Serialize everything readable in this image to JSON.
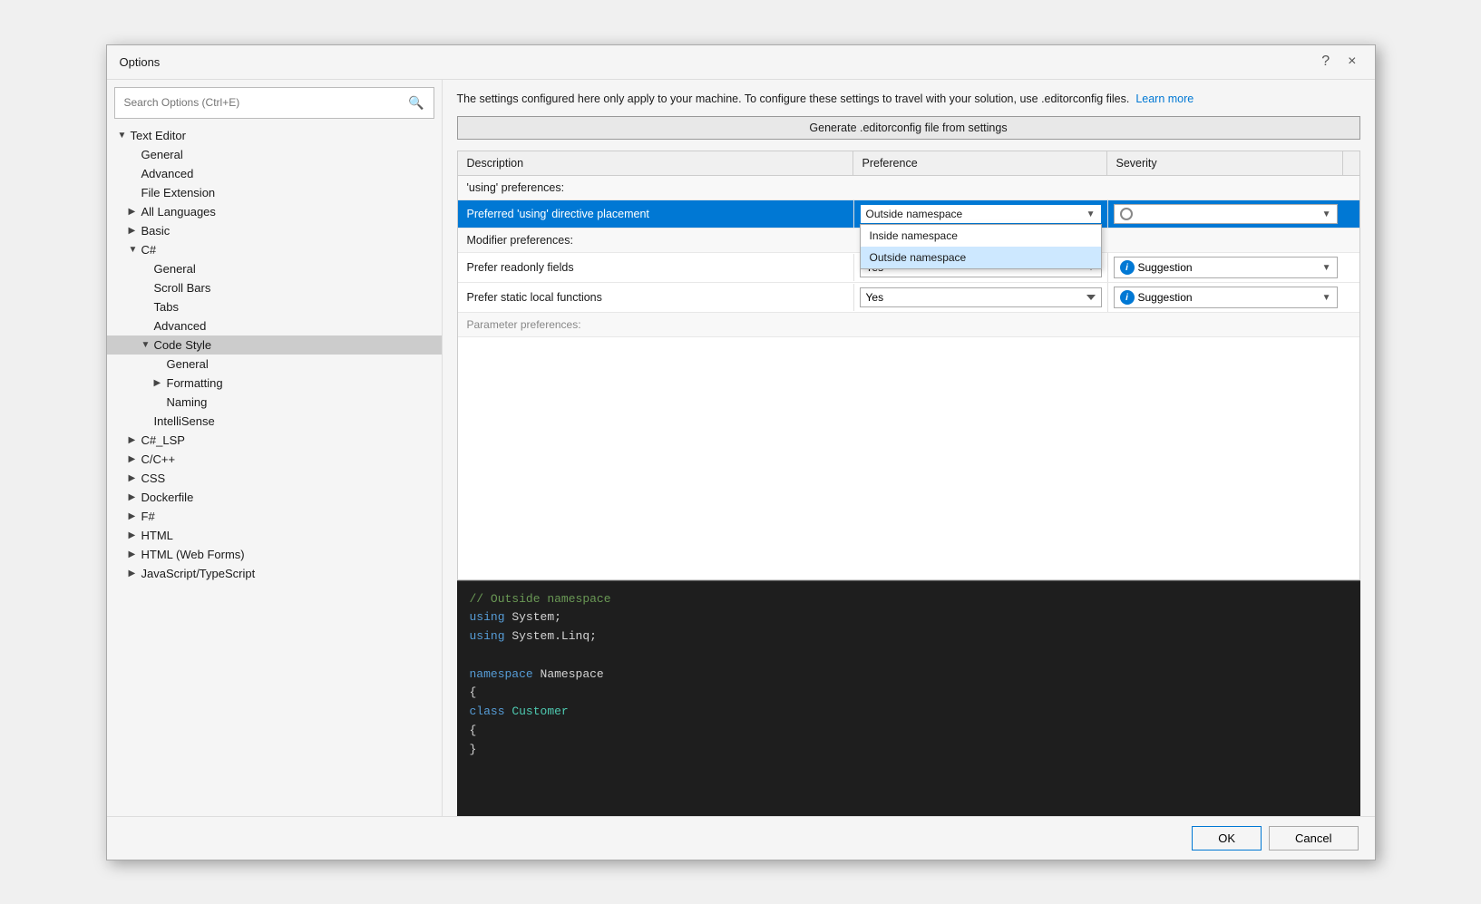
{
  "dialog": {
    "title": "Options",
    "help_btn": "?",
    "close_btn": "×"
  },
  "search": {
    "placeholder": "Search Options (Ctrl+E)"
  },
  "tree": {
    "items": [
      {
        "id": "text-editor",
        "label": "Text Editor",
        "indent": 0,
        "expanded": true,
        "hasArrow": true,
        "arrowDown": true
      },
      {
        "id": "general",
        "label": "General",
        "indent": 1,
        "expanded": false,
        "hasArrow": false
      },
      {
        "id": "advanced-te",
        "label": "Advanced",
        "indent": 1,
        "expanded": false,
        "hasArrow": false
      },
      {
        "id": "file-extension",
        "label": "File Extension",
        "indent": 1,
        "expanded": false,
        "hasArrow": false
      },
      {
        "id": "all-languages",
        "label": "All Languages",
        "indent": 1,
        "expanded": false,
        "hasArrow": true,
        "arrowDown": false
      },
      {
        "id": "basic",
        "label": "Basic",
        "indent": 1,
        "expanded": false,
        "hasArrow": true,
        "arrowDown": false
      },
      {
        "id": "csharp",
        "label": "C#",
        "indent": 1,
        "expanded": true,
        "hasArrow": true,
        "arrowDown": true
      },
      {
        "id": "csharp-general",
        "label": "General",
        "indent": 2,
        "expanded": false,
        "hasArrow": false
      },
      {
        "id": "scroll-bars",
        "label": "Scroll Bars",
        "indent": 2,
        "expanded": false,
        "hasArrow": false
      },
      {
        "id": "tabs",
        "label": "Tabs",
        "indent": 2,
        "expanded": false,
        "hasArrow": false
      },
      {
        "id": "advanced-cs",
        "label": "Advanced",
        "indent": 2,
        "expanded": false,
        "hasArrow": false
      },
      {
        "id": "code-style",
        "label": "Code Style",
        "indent": 2,
        "expanded": true,
        "hasArrow": true,
        "arrowDown": true,
        "selected": true
      },
      {
        "id": "cs-general",
        "label": "General",
        "indent": 3,
        "expanded": false,
        "hasArrow": false
      },
      {
        "id": "formatting",
        "label": "Formatting",
        "indent": 3,
        "expanded": false,
        "hasArrow": true,
        "arrowDown": false
      },
      {
        "id": "naming",
        "label": "Naming",
        "indent": 3,
        "expanded": false,
        "hasArrow": false
      },
      {
        "id": "intellisense",
        "label": "IntelliSense",
        "indent": 2,
        "expanded": false,
        "hasArrow": false
      },
      {
        "id": "csharp-lsp",
        "label": "C#_LSP",
        "indent": 1,
        "expanded": false,
        "hasArrow": true,
        "arrowDown": false
      },
      {
        "id": "cpp",
        "label": "C/C++",
        "indent": 1,
        "expanded": false,
        "hasArrow": true,
        "arrowDown": false
      },
      {
        "id": "css",
        "label": "CSS",
        "indent": 1,
        "expanded": false,
        "hasArrow": true,
        "arrowDown": false
      },
      {
        "id": "dockerfile",
        "label": "Dockerfile",
        "indent": 1,
        "expanded": false,
        "hasArrow": true,
        "arrowDown": false
      },
      {
        "id": "fsharp",
        "label": "F#",
        "indent": 1,
        "expanded": false,
        "hasArrow": true,
        "arrowDown": false
      },
      {
        "id": "html",
        "label": "HTML",
        "indent": 1,
        "expanded": false,
        "hasArrow": true,
        "arrowDown": false
      },
      {
        "id": "html-webforms",
        "label": "HTML (Web Forms)",
        "indent": 1,
        "expanded": false,
        "hasArrow": true,
        "arrowDown": false
      },
      {
        "id": "javascript",
        "label": "JavaScript/TypeScript",
        "indent": 1,
        "expanded": false,
        "hasArrow": true,
        "arrowDown": false
      }
    ]
  },
  "info_text": "The settings configured here only apply to your machine. To configure these settings to travel with your solution, use .editorconfig files.",
  "learn_more": "Learn more",
  "generate_btn": "Generate .editorconfig file from settings",
  "table": {
    "headers": [
      "Description",
      "Preference",
      "Severity",
      ""
    ],
    "sections": [
      {
        "label": "'using' preferences:",
        "rows": [
          {
            "id": "preferred-using",
            "desc": "Preferred 'using' directive placement",
            "pref": "Outside namespace",
            "pref_dropdown": true,
            "pref_open": true,
            "sev": "Refactoring Only",
            "sev_type": "radio",
            "highlighted": true,
            "dropdown_options": [
              "Inside namespace",
              "Outside namespace"
            ],
            "selected_option": "Outside namespace"
          }
        ]
      },
      {
        "label": "Modifier preferences:",
        "rows": [
          {
            "id": "prefer-readonly",
            "desc": "Prefer readonly fields",
            "pref": "Yes",
            "pref_dropdown": true,
            "sev": "Suggestion",
            "sev_type": "info"
          },
          {
            "id": "prefer-static",
            "desc": "Prefer static local functions",
            "pref": "Yes",
            "pref_dropdown": true,
            "sev": "Suggestion",
            "sev_type": "info"
          }
        ]
      },
      {
        "label": "Parameter preferences:",
        "rows": []
      }
    ]
  },
  "code_preview": {
    "lines": [
      {
        "tokens": [
          {
            "text": "// Outside namespace",
            "class": "code-comment"
          }
        ]
      },
      {
        "tokens": [
          {
            "text": "using",
            "class": "code-kw"
          },
          {
            "text": " System;",
            "class": "code-white"
          }
        ]
      },
      {
        "tokens": [
          {
            "text": "using",
            "class": "code-kw"
          },
          {
            "text": " System.Linq;",
            "class": "code-white"
          }
        ]
      },
      {
        "tokens": [
          {
            "text": "",
            "class": ""
          }
        ]
      },
      {
        "tokens": [
          {
            "text": "namespace",
            "class": "code-kw"
          },
          {
            "text": " Namespace",
            "class": "code-white"
          }
        ]
      },
      {
        "tokens": [
          {
            "text": "{",
            "class": "code-white"
          }
        ]
      },
      {
        "tokens": [
          {
            "text": "    ",
            "class": ""
          },
          {
            "text": "class",
            "class": "code-kw"
          },
          {
            "text": " ",
            "class": ""
          },
          {
            "text": "Customer",
            "class": "code-type"
          }
        ]
      },
      {
        "tokens": [
          {
            "text": "    {",
            "class": "code-white"
          }
        ]
      },
      {
        "tokens": [
          {
            "text": "    }",
            "class": "code-white"
          }
        ]
      }
    ]
  },
  "footer": {
    "ok": "OK",
    "cancel": "Cancel"
  }
}
